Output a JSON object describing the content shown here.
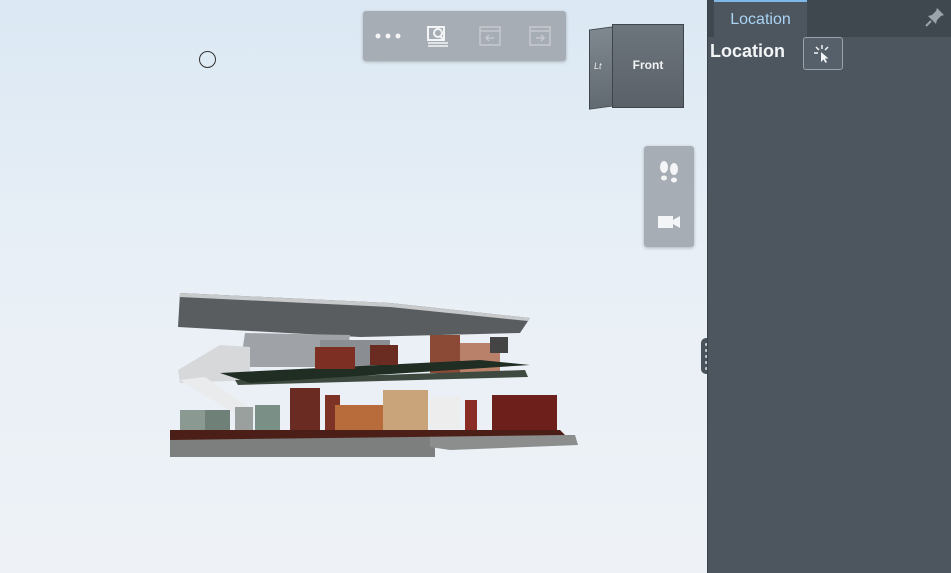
{
  "viewport": {
    "background": "#e9f0f6",
    "toolbar": {
      "buttons": [
        {
          "icon": "more-icon",
          "label": "More"
        },
        {
          "icon": "zoom-fit-icon",
          "label": "Fit to view"
        },
        {
          "icon": "undo-view-icon",
          "label": "Previous view"
        },
        {
          "icon": "redo-view-icon",
          "label": "Next view"
        }
      ]
    },
    "viewcube": {
      "face_label": "Front",
      "side_label": "Left"
    },
    "nav_tools": [
      {
        "icon": "walk-footprints-icon"
      },
      {
        "icon": "camera-icon"
      }
    ]
  },
  "panel": {
    "tab_label": "Location",
    "title": "Location",
    "accent": "#7fb8e6",
    "pin_icon": "pin-icon",
    "pick_button_icon": "pick-location-icon"
  }
}
